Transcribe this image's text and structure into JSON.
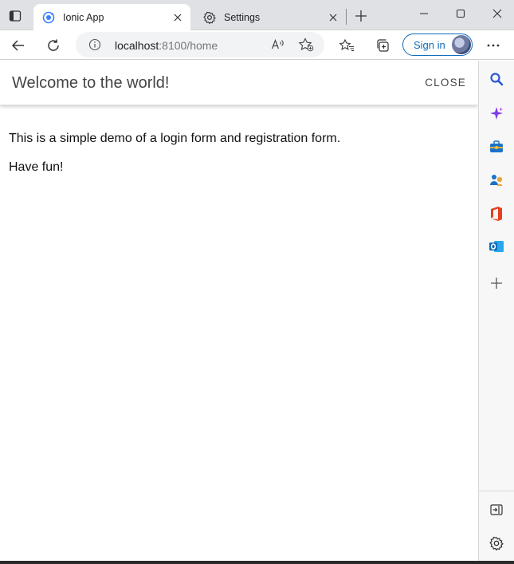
{
  "browser": {
    "tabs": [
      {
        "title": "Ionic App",
        "icon": "ionic-icon",
        "active": true
      },
      {
        "title": "Settings",
        "icon": "gear-icon",
        "active": false
      }
    ],
    "address_bar": {
      "host": "localhost",
      "path": ":8100/home"
    },
    "sign_in_label": "Sign in",
    "accent": "#0f6cbd"
  },
  "app": {
    "header_title": "Welcome to the world!",
    "close_label": "CLOSE",
    "paragraphs": [
      "This is a simple demo of a login form and registration form.",
      "Have fun!"
    ]
  },
  "sidebar": {
    "items": [
      "search-icon",
      "copilot-icon",
      "tools-icon",
      "people-icon",
      "office-icon",
      "outlook-icon",
      "add-icon"
    ],
    "bottom_items": [
      "hide-sidebar-icon",
      "settings-icon"
    ]
  }
}
